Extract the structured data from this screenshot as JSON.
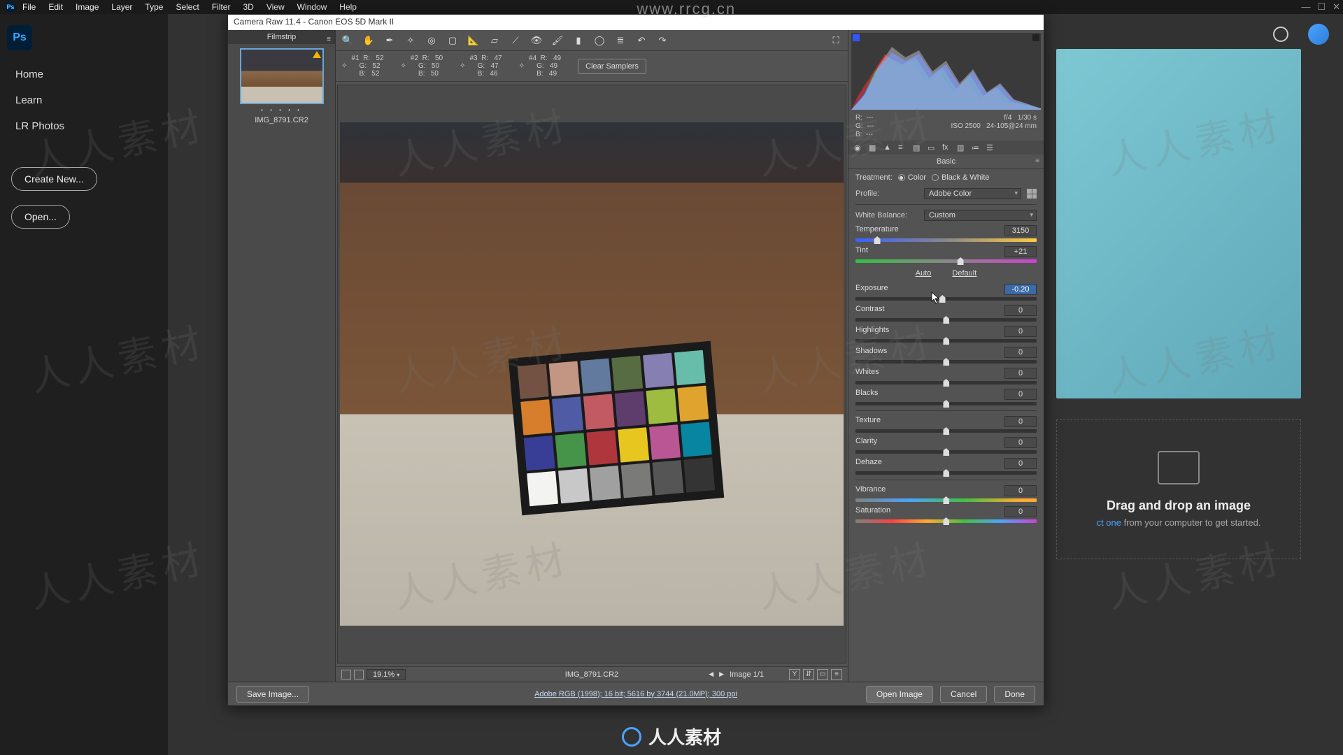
{
  "menu": {
    "items": [
      "File",
      "Edit",
      "Image",
      "Layer",
      "Type",
      "Select",
      "Filter",
      "3D",
      "View",
      "Window",
      "Help"
    ]
  },
  "left": {
    "nav": [
      "Home",
      "Learn",
      "LR Photos"
    ],
    "create": "Create New...",
    "open": "Open..."
  },
  "drag": {
    "title": "Drag and drop an image",
    "sub_link": "ct one",
    "sub_rest": " from your computer to get started."
  },
  "cr": {
    "title": "Camera Raw 11.4  -  Canon EOS 5D Mark II",
    "filmstrip": "Filmstrip",
    "thumb_name": "IMG_8791.CR2",
    "samplers": [
      {
        "n": "#1",
        "r": "52",
        "g": "52",
        "b": "52"
      },
      {
        "n": "#2",
        "r": "50",
        "g": "50",
        "b": "50"
      },
      {
        "n": "#3",
        "r": "47",
        "g": "47",
        "b": "46"
      },
      {
        "n": "#4",
        "r": "49",
        "g": "49",
        "b": "49"
      }
    ],
    "clear": "Clear Samplers",
    "zoom": "19.1%",
    "canvas_name": "IMG_8791.CR2",
    "image_nav": "Image 1/1",
    "save": "Save Image...",
    "meta": "Adobe RGB (1998); 16 bit; 5616 by 3744 (21.0MP); 300 ppi",
    "open_img": "Open Image",
    "cancel": "Cancel",
    "done": "Done"
  },
  "info": {
    "rgb": [
      "R:",
      "G:",
      "B:"
    ],
    "rgb_v": [
      "---",
      "---",
      "---"
    ],
    "fstop": "f/4",
    "shutter": "1/30 s",
    "iso": "ISO 2500",
    "lens": "24-105@24 mm"
  },
  "basic": {
    "panel": "Basic",
    "treatment": "Treatment:",
    "color": "Color",
    "bw": "Black & White",
    "profile": "Profile:",
    "profile_val": "Adobe Color",
    "wb": "White Balance:",
    "wb_val": "Custom",
    "temp": "Temperature",
    "temp_val": "3150",
    "tint": "Tint",
    "tint_val": "+21",
    "auto": "Auto",
    "default": "Default",
    "exposure": "Exposure",
    "exposure_val": "-0.20",
    "contrast": "Contrast",
    "contrast_val": "0",
    "highlights": "Highlights",
    "highlights_val": "0",
    "shadows": "Shadows",
    "shadows_val": "0",
    "whites": "Whites",
    "whites_val": "0",
    "blacks": "Blacks",
    "blacks_val": "0",
    "texture": "Texture",
    "texture_val": "0",
    "clarity": "Clarity",
    "clarity_val": "0",
    "dehaze": "Dehaze",
    "dehaze_val": "0",
    "vibrance": "Vibrance",
    "vibrance_val": "0",
    "saturation": "Saturation",
    "saturation_val": "0"
  },
  "colorchecker": [
    "#735244",
    "#c29682",
    "#627a9d",
    "#576c43",
    "#8580b1",
    "#67bdaa",
    "#d67e2c",
    "#505ba6",
    "#c15a63",
    "#5e3c6c",
    "#9dbc40",
    "#e0a32e",
    "#383d96",
    "#469449",
    "#af363c",
    "#e7c71f",
    "#bb5695",
    "#0885a1",
    "#f3f3f2",
    "#c8c8c8",
    "#a0a0a0",
    "#7a7a79",
    "#555555",
    "#343434"
  ],
  "watermark": {
    "text": "人人素材",
    "url": "www.rrcg.cn",
    "logo": "人人素材"
  }
}
